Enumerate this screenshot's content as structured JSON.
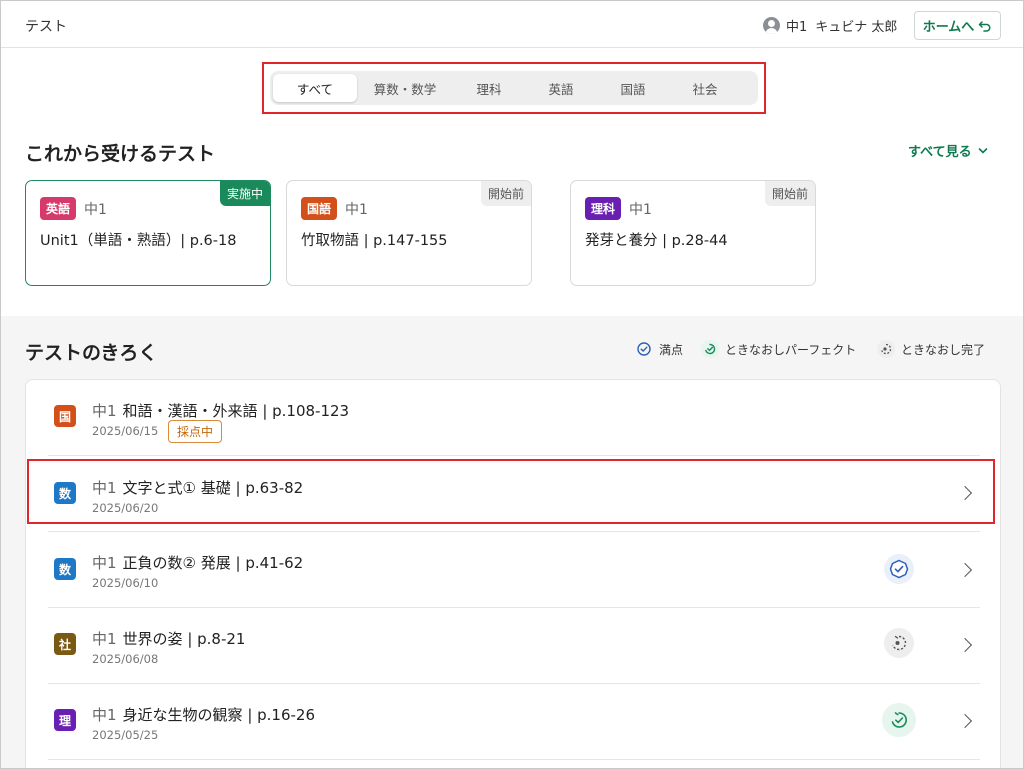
{
  "header": {
    "title": "テスト",
    "user_grade": "中1",
    "user_name": "キュビナ 太郎",
    "home_label": "ホームへ"
  },
  "tabs": [
    {
      "label": "すべて",
      "active": true
    },
    {
      "label": "算数・数学",
      "active": false
    },
    {
      "label": "理科",
      "active": false
    },
    {
      "label": "英語",
      "active": false
    },
    {
      "label": "国語",
      "active": false
    },
    {
      "label": "社会",
      "active": false
    }
  ],
  "upcoming": {
    "title": "これから受けるテスト",
    "see_all": "すべて見る",
    "cards": [
      {
        "subject": "英語",
        "grade": "中1",
        "title": "Unit1（単語・熟語）| p.6-18",
        "status": "実施中"
      },
      {
        "subject": "国語",
        "grade": "中1",
        "title": "竹取物語 | p.147-155",
        "status": "開始前"
      },
      {
        "subject": "理科",
        "grade": "中1",
        "title": "発芽と養分 | p.28-44",
        "status": "開始前"
      }
    ]
  },
  "history": {
    "title": "テストのきろく",
    "legend": {
      "perfect": "満点",
      "retry_perfect": "ときなおしパーフェクト",
      "retry_done": "ときなおし完了"
    },
    "rows": [
      {
        "subject": "国",
        "grade": "中1",
        "title": "和語・漢語・外来語 | p.108-123",
        "date": "2025/06/15",
        "status": "採点中"
      },
      {
        "subject": "数",
        "grade": "中1",
        "title": "文字と式① 基礎 | p.63-82",
        "date": "2025/06/20"
      },
      {
        "subject": "数",
        "grade": "中1",
        "title": "正負の数② 発展 | p.41-62",
        "date": "2025/06/10"
      },
      {
        "subject": "社",
        "grade": "中1",
        "title": "世界の姿 | p.8-21",
        "date": "2025/06/08"
      },
      {
        "subject": "理",
        "grade": "中1",
        "title": "身近な生物の観察 | p.16-26",
        "date": "2025/05/25"
      }
    ]
  },
  "colors": {
    "accent_green": "#0f7a4f",
    "english": "#d63a6a",
    "japanese": "#d3501a",
    "science": "#6a1fb3",
    "math": "#1e78c8",
    "social": "#7a5a12",
    "highlight": "#e0262c"
  }
}
